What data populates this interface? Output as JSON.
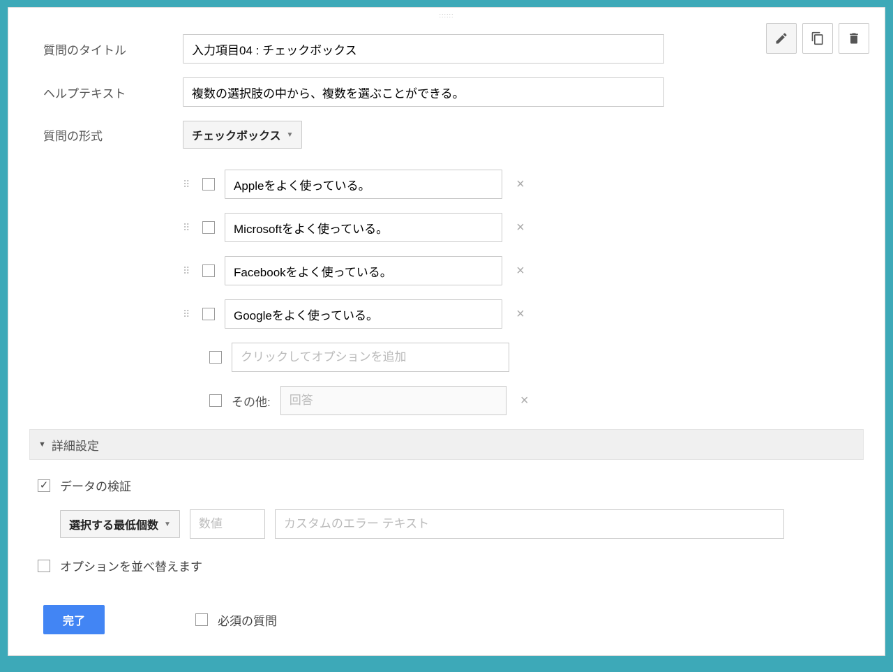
{
  "labels": {
    "question_title": "質問のタイトル",
    "help_text": "ヘルプテキスト",
    "question_type": "質問の形式"
  },
  "fields": {
    "title_value": "入力項目04 : チェックボックス",
    "help_value": "複数の選択肢の中から、複数を選ぶことができる。",
    "type_value": "チェックボックス"
  },
  "options": [
    {
      "text": "Appleをよく使っている。"
    },
    {
      "text": "Microsoftをよく使っている。"
    },
    {
      "text": "Facebookをよく使っている。"
    },
    {
      "text": "Googleをよく使っている。"
    }
  ],
  "add_option_placeholder": "クリックしてオプションを追加",
  "other": {
    "label": "その他:",
    "placeholder": "回答"
  },
  "advanced": {
    "header": "詳細設定",
    "data_validation": "データの検証",
    "validation_dropdown": "選択する最低個数",
    "number_placeholder": "数値",
    "error_placeholder": "カスタムのエラー テキスト",
    "reorder": "オプションを並べ替えます"
  },
  "footer": {
    "done": "完了",
    "required": "必須の質問"
  },
  "icons": {
    "remove": "×"
  }
}
